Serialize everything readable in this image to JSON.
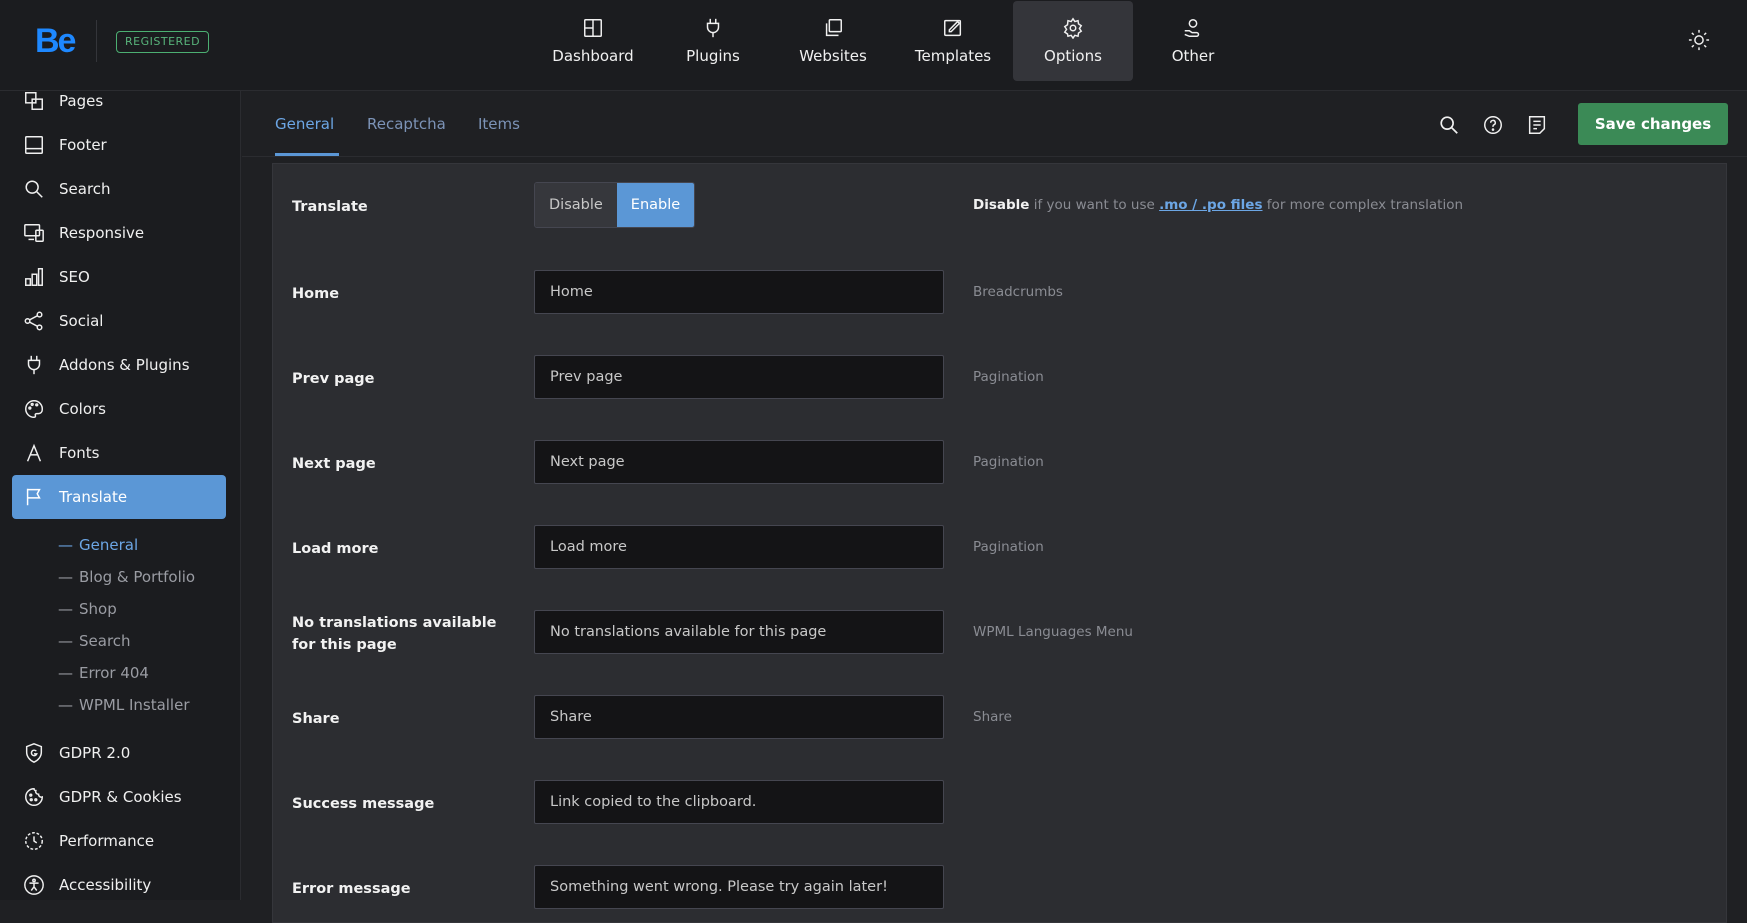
{
  "brand": {
    "logo": "Be",
    "badge": "REGISTERED"
  },
  "topnav": [
    {
      "label": "Dashboard",
      "icon": "dashboard-icon"
    },
    {
      "label": "Plugins",
      "icon": "plug-icon"
    },
    {
      "label": "Websites",
      "icon": "websites-icon"
    },
    {
      "label": "Templates",
      "icon": "templates-icon"
    },
    {
      "label": "Options",
      "icon": "gear-icon",
      "active": true
    },
    {
      "label": "Other",
      "icon": "hand-user-icon"
    }
  ],
  "sidebar": {
    "items": [
      {
        "label": "Pages",
        "icon": "pages-icon"
      },
      {
        "label": "Footer",
        "icon": "footer-icon"
      },
      {
        "label": "Search",
        "icon": "search-icon"
      },
      {
        "label": "Responsive",
        "icon": "responsive-icon"
      },
      {
        "label": "SEO",
        "icon": "chart-bars-icon"
      },
      {
        "label": "Social",
        "icon": "share-icon"
      },
      {
        "label": "Addons & Plugins",
        "icon": "plug-icon"
      },
      {
        "label": "Colors",
        "icon": "palette-icon"
      },
      {
        "label": "Fonts",
        "icon": "font-icon"
      },
      {
        "label": "Translate",
        "icon": "flag-icon",
        "active": true
      }
    ],
    "subitems": [
      {
        "label": "General",
        "active": true
      },
      {
        "label": "Blog & Portfolio"
      },
      {
        "label": "Shop"
      },
      {
        "label": "Search"
      },
      {
        "label": "Error 404"
      },
      {
        "label": "WPML Installer"
      }
    ],
    "bottom_items": [
      {
        "label": "GDPR 2.0",
        "icon": "shield-g-icon"
      },
      {
        "label": "GDPR & Cookies",
        "icon": "cookie-icon"
      },
      {
        "label": "Performance",
        "icon": "performance-icon"
      },
      {
        "label": "Accessibility",
        "icon": "accessibility-icon"
      }
    ]
  },
  "tabs": [
    {
      "label": "General",
      "active": true
    },
    {
      "label": "Recaptcha"
    },
    {
      "label": "Items"
    }
  ],
  "toolbar": {
    "save_label": "Save changes"
  },
  "translate_row": {
    "label": "Translate",
    "options": [
      "Disable",
      "Enable"
    ],
    "selected": "Enable",
    "hint_strong": "Disable",
    "hint_pre": " if you want to use ",
    "hint_link": ".mo / .po files",
    "hint_post": " for more complex translation"
  },
  "rows": [
    {
      "label": "Home",
      "value": "Home",
      "hint": "Breadcrumbs"
    },
    {
      "label": "Prev page",
      "value": "Prev page",
      "hint": "Pagination"
    },
    {
      "label": "Next page",
      "value": "Next page",
      "hint": "Pagination"
    },
    {
      "label": "Load more",
      "value": "Load more",
      "hint": "Pagination"
    },
    {
      "label": "No translations available for this page",
      "value": "No translations available for this page",
      "hint": "WPML Languages Menu"
    },
    {
      "label": "Share",
      "value": "Share",
      "hint": "Share"
    },
    {
      "label": "Success message",
      "value": "Link copied to the clipboard.",
      "hint": ""
    },
    {
      "label": "Error message",
      "value": "Something went wrong. Please try again later!",
      "hint": ""
    }
  ]
}
